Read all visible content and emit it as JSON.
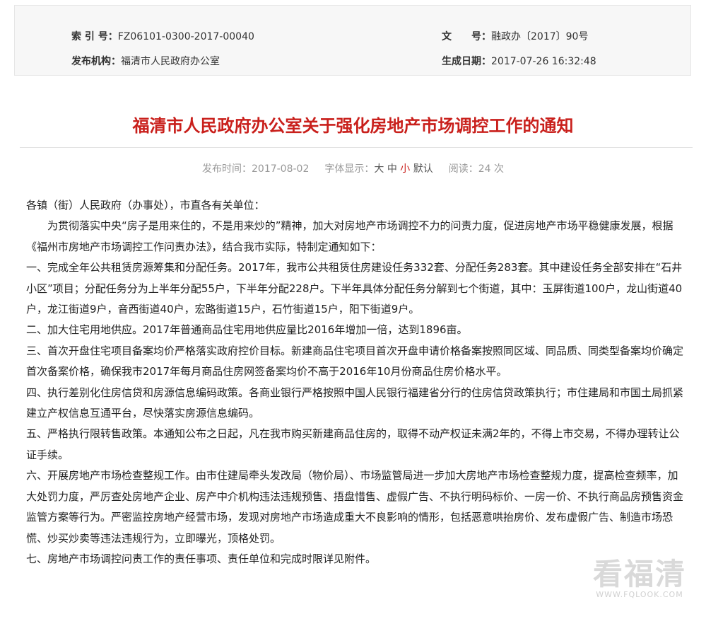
{
  "meta": {
    "index_label": "索 引 号：",
    "index_value": "FZ06101-0300-2017-00040",
    "doc_no_label": "文　　号：",
    "doc_no_value": "融政办〔2017〕90号",
    "publisher_label": "发布机构：",
    "publisher_value": "福清市人民政府办公室",
    "gen_date_label": "生成日期：",
    "gen_date_value": "2017-07-26 16:32:48"
  },
  "title": "福清市人民政府办公室关于强化房地产市场调控工作的通知",
  "info": {
    "publish_time": "发布时间：2017-08-02",
    "font_label": "字体显示：",
    "font_large": "大",
    "font_medium": "中",
    "font_small": "小",
    "font_default": "默认",
    "reads": "阅读：24 次"
  },
  "body": {
    "salutation": "各镇（街）人民政府（办事处），市直各有关单位：",
    "intro": "为贯彻落实中央“房子是用来住的，不是用来炒的”精神，加大对房地产市场调控不力的问责力度，促进房地产市场平稳健康发展，根据《福州市房地产市场调控工作问责办法》，结合我市实际，特制定通知如下：",
    "items": [
      "一、完成全年公共租赁房源筹集和分配任务。2017年，我市公共租赁住房建设任务332套、分配任务283套。其中建设任务全部安排在“石井小区”项目；分配任务分为上半年分配55户，下半年分配228户。下半年具体分配任务分解到七个街道，其中：玉屏街道100户，龙山街道40户，龙江街道9户，音西街道40户，宏路街道15户，石竹街道15户，阳下街道9户。",
      "二、加大住宅用地供应。2017年普通商品住宅用地供应量比2016年增加一倍，达到1896亩。",
      "三、首次开盘住宅项目备案均价严格落实政府控价目标。新建商品住宅项目首次开盘申请价格备案按照同区域、同品质、同类型备案均价确定首次备案价格，确保我市2017年每月商品住房网签备案均价不高于2016年10月份商品住房价格水平。",
      "四、执行差别化住房信贷和房源信息编码政策。各商业银行严格按照中国人民银行福建省分行的住房信贷政策执行；市住建局和市国土局抓紧建立产权信息互通平台，尽快落实房源信息编码。",
      "五、严格执行限转售政策。本通知公布之日起，凡在我市购买新建商品住房的，取得不动产权证未满2年的，不得上市交易，不得办理转让公证手续。",
      "六、开展房地产市场检查整规工作。由市住建局牵头发改局（物价局）、市场监管局进一步加大房地产市场检查整规力度，提高检查频率，加大处罚力度，严厉查处房地产企业、房产中介机构违法违规预售、捂盘惜售、虚假广告、不执行明码标价、一房一价、不执行商品房预售资金监管方案等行为。严密监控房地产经营市场，发现对房地产市场造成重大不良影响的情形，包括恶意哄抬房价、发布虚假广告、制造市场恐慌、炒买炒卖等违法违规行为，立即曝光，顶格处罚。",
      "七、房地产市场调控问责工作的责任事项、责任单位和完成时限详见附件。"
    ]
  },
  "watermark": {
    "main": "看福清",
    "sub": "WWW.FQLOOK.COM"
  },
  "colors": {
    "title": "#c9201c",
    "meta_bg": "#f7f7f7",
    "info_text": "#999999"
  }
}
